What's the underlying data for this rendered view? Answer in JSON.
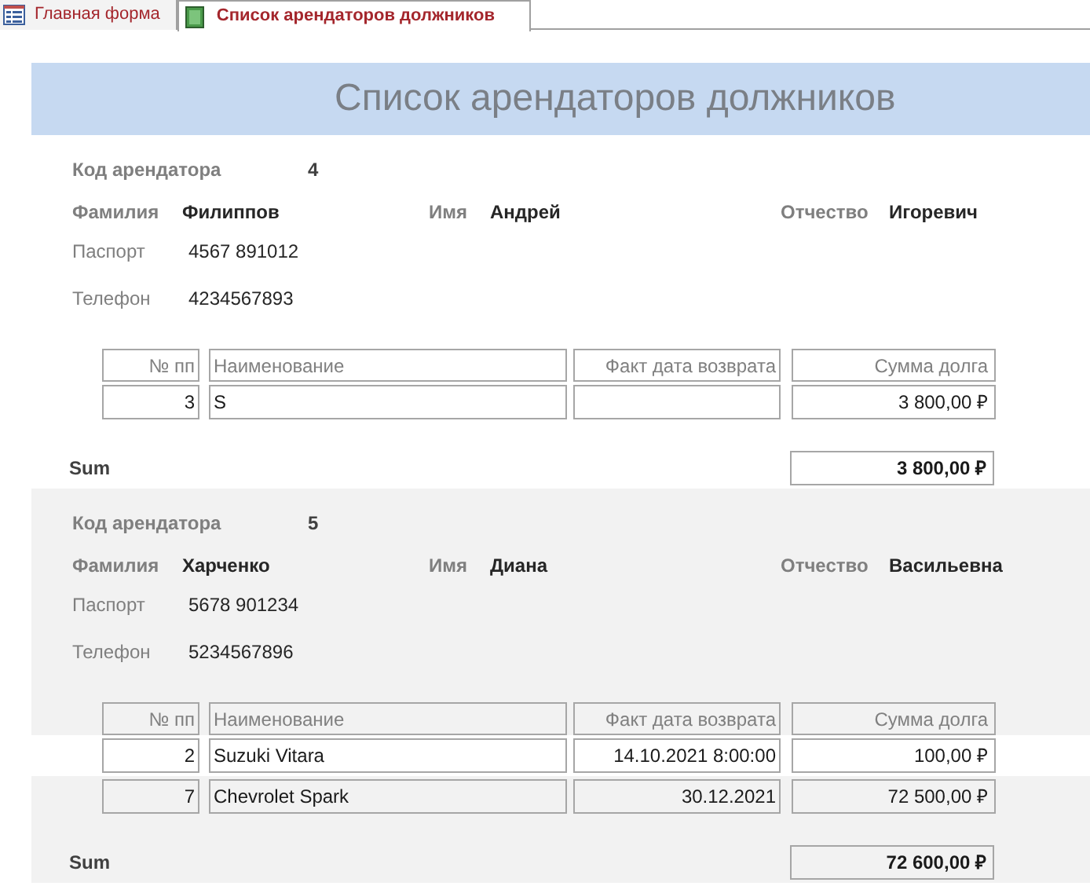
{
  "tabs": [
    {
      "label": "Главная форма",
      "kind": "form",
      "selected": false
    },
    {
      "label": "Список арендаторов должников",
      "kind": "report",
      "selected": true
    }
  ],
  "report": {
    "title": "Список арендаторов должников",
    "groups": [
      {
        "code_label": "Код арендатора",
        "code": "4",
        "name_fields": [
          {
            "label": "Фамилия",
            "value": "Филиппов"
          },
          {
            "label": "Имя",
            "value": "Андрей"
          },
          {
            "label": "Отчество",
            "value": "Игоревич"
          }
        ],
        "info_fields": [
          {
            "label": "Паспорт",
            "value": "4567 891012"
          },
          {
            "label": "Телефон",
            "value": "4234567893"
          }
        ],
        "columns": [
          "№ пп",
          "Наименование",
          "Факт дата возврата",
          "Сумма долга"
        ],
        "rows": [
          {
            "number": "3",
            "name": "S",
            "debt": "3 800,00 ₽"
          }
        ],
        "sum": {
          "label": "Sum",
          "value": "3 800,00 ₽"
        }
      },
      {
        "code_label": "Код арендатора",
        "code": "5",
        "name_fields": [
          {
            "label": "Фамилия",
            "value": "Харченко"
          },
          {
            "label": "Имя",
            "value": "Диана"
          },
          {
            "label": "Отчество",
            "value": "Васильевна"
          }
        ],
        "info_fields": [
          {
            "label": "Паспорт",
            "value": "5678 901234"
          },
          {
            "label": "Телефон",
            "value": "5234567896"
          }
        ],
        "columns": [
          "№ пп",
          "Наименование",
          "Факт дата возврата",
          "Сумма долга"
        ],
        "rows": [
          {
            "number": "2",
            "name": "Suzuki Vitara",
            "return_date": "14.10.2021 8:00:00",
            "debt": "100,00 ₽"
          },
          {
            "number": "7",
            "name": "Chevrolet Spark",
            "return_date": "30.12.2021",
            "debt": "72 500,00 ₽"
          }
        ],
        "sum": {
          "label": "Sum",
          "value": "72 600,00 ₽"
        }
      }
    ]
  }
}
